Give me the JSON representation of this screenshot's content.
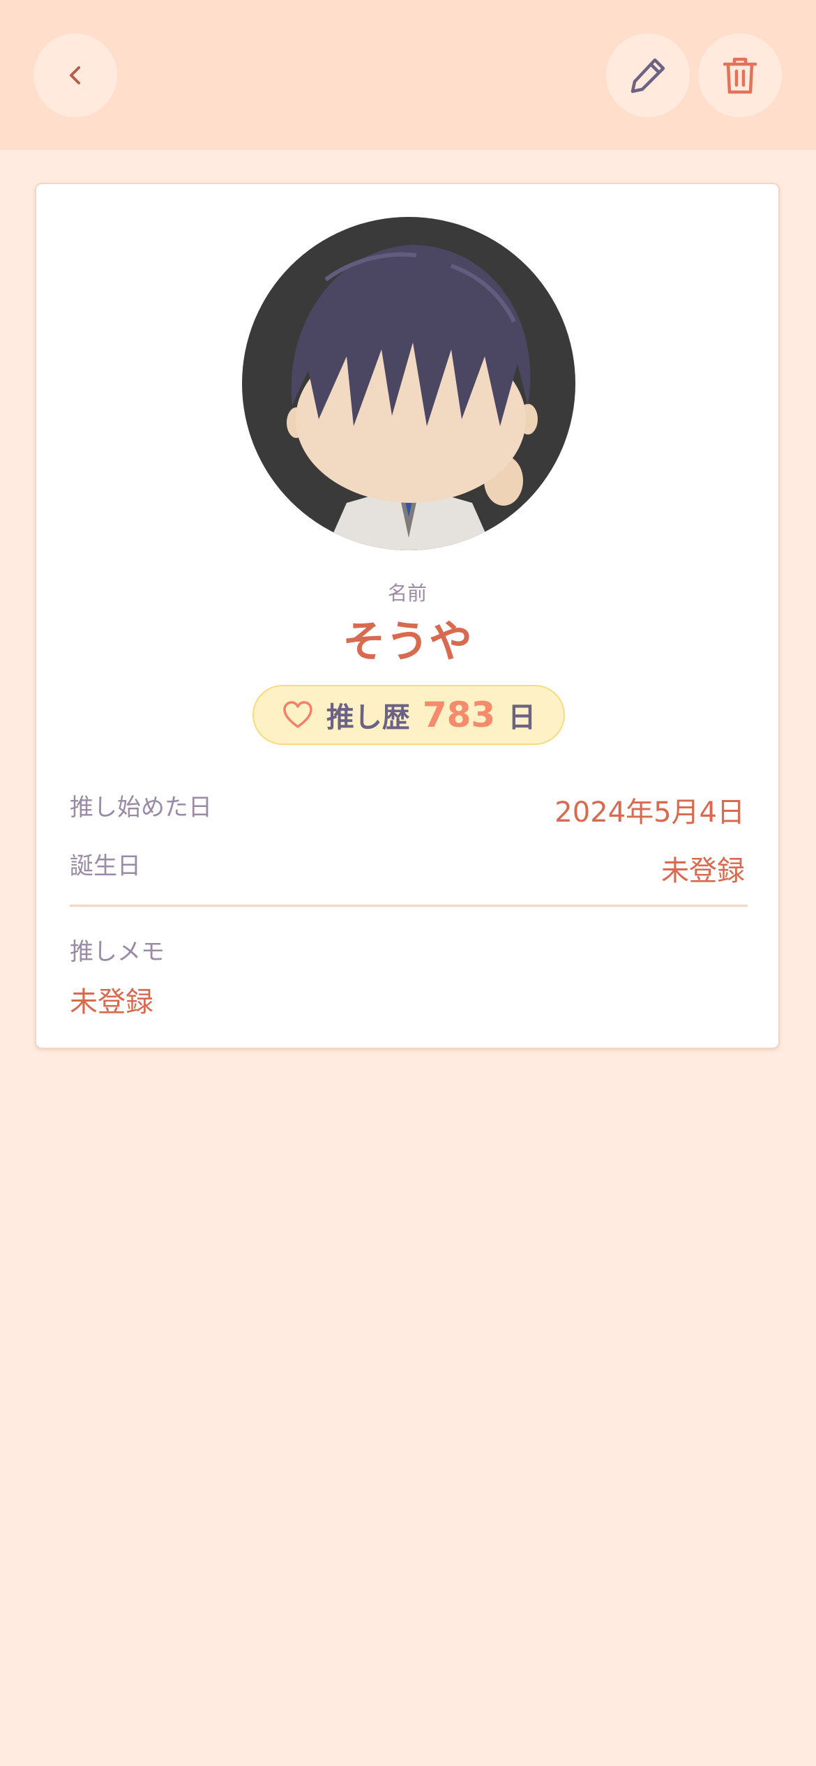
{
  "header": {
    "back_icon": "chevron-left-icon",
    "edit_icon": "pencil-icon",
    "delete_icon": "trash-icon"
  },
  "profile": {
    "name_label": "名前",
    "name": "そうや",
    "badge": {
      "icon": "heart-icon",
      "label": "推し歴",
      "days": "783",
      "unit": "日"
    },
    "start_date_label": "推し始めた日",
    "start_date_value": "2024年5月4日",
    "birthday_label": "誕生日",
    "birthday_value": "未登録",
    "memo_label": "推しメモ",
    "memo_value": "未登録"
  },
  "colors": {
    "background": "#FFEBDF",
    "header": "#FFDFCB",
    "accent": "#D86A50",
    "muted": "#9A8AA6",
    "badge_bg": "#FFF1C6"
  }
}
